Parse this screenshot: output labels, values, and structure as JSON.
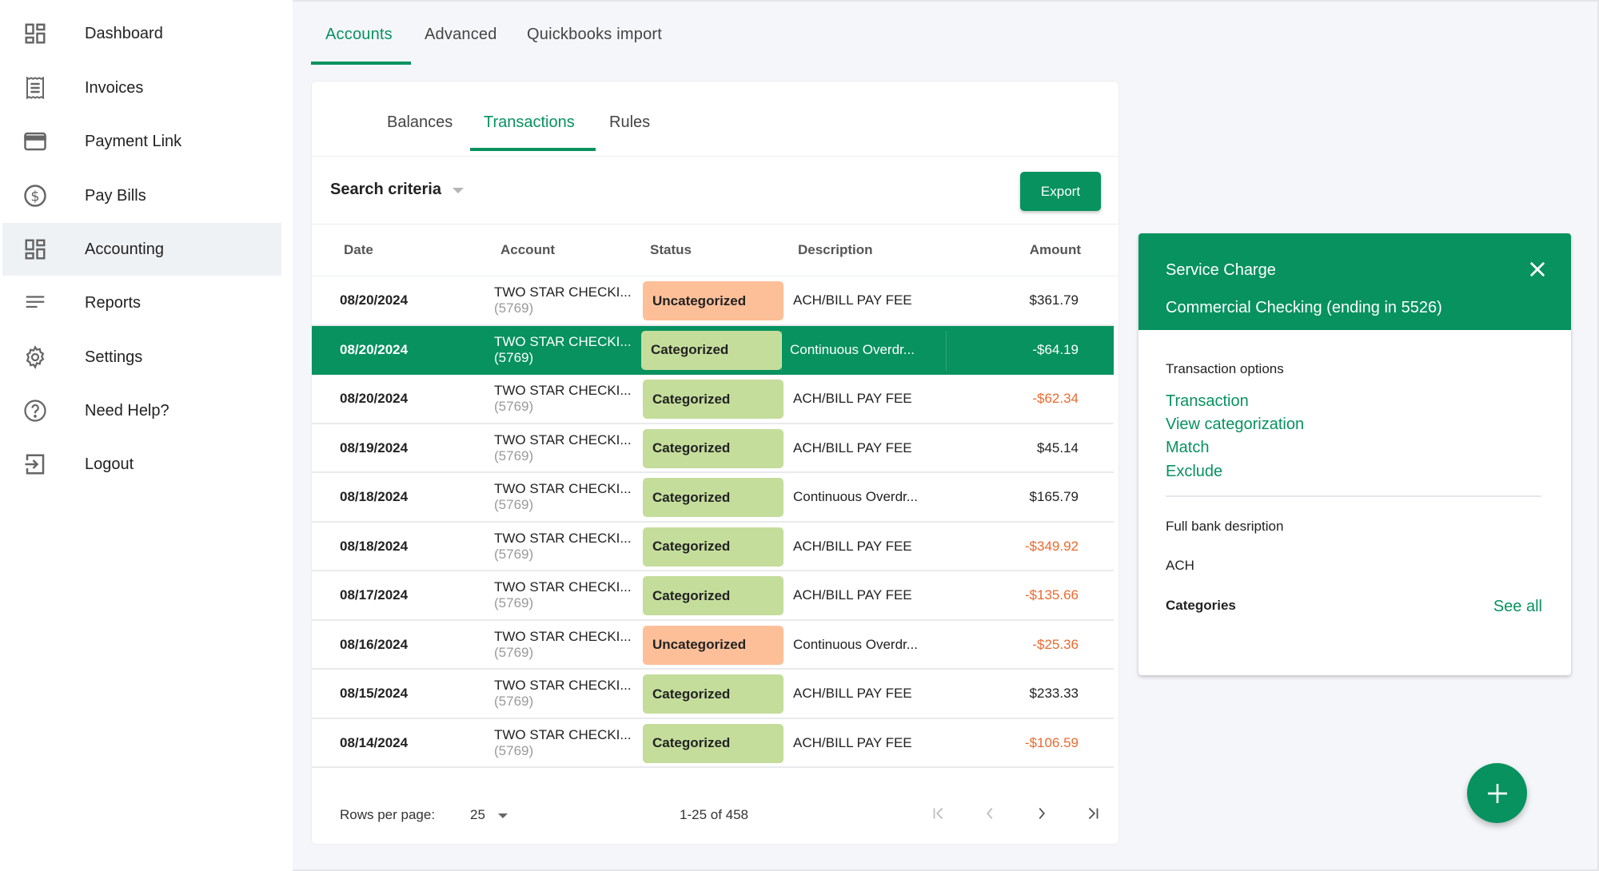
{
  "sidebar": {
    "items": [
      {
        "label": "Dashboard",
        "icon": "dashboard-icon"
      },
      {
        "label": "Invoices",
        "icon": "receipt-icon"
      },
      {
        "label": "Payment Link",
        "icon": "credit-card-icon"
      },
      {
        "label": "Pay Bills",
        "icon": "dollar-circle-icon"
      },
      {
        "label": "Accounting",
        "icon": "dashboard-icon",
        "active": true
      },
      {
        "label": "Reports",
        "icon": "lines-icon"
      },
      {
        "label": "Settings",
        "icon": "gear-icon"
      },
      {
        "label": "Need Help?",
        "icon": "help-circle-icon"
      },
      {
        "label": "Logout",
        "icon": "logout-icon"
      }
    ]
  },
  "top_tabs": [
    {
      "label": "Accounts",
      "active": true
    },
    {
      "label": "Advanced"
    },
    {
      "label": "Quickbooks import"
    }
  ],
  "sub_tabs": [
    {
      "label": "Balances"
    },
    {
      "label": "Transactions",
      "active": true
    },
    {
      "label": "Rules"
    }
  ],
  "toolbar": {
    "search_criteria_label": "Search criteria",
    "export_label": "Export"
  },
  "table": {
    "columns": [
      "Date",
      "Account",
      "Status",
      "Description",
      "Amount"
    ],
    "rows": [
      {
        "date": "08/20/2024",
        "account": "TWO STAR CHECKI...",
        "account_num": "(5769)",
        "status": "Uncategorized",
        "description": "ACH/BILL PAY FEE",
        "amount": "$361.79",
        "negative": false
      },
      {
        "date": "08/20/2024",
        "account": "TWO STAR CHECKI...",
        "account_num": "(5769)",
        "status": "Categorized",
        "description": "Continuous Overdr...",
        "amount": "-$64.19",
        "negative": true,
        "selected": true
      },
      {
        "date": "08/20/2024",
        "account": "TWO STAR CHECKI...",
        "account_num": "(5769)",
        "status": "Categorized",
        "description": "ACH/BILL PAY FEE",
        "amount": "-$62.34",
        "negative": true
      },
      {
        "date": "08/19/2024",
        "account": "TWO STAR CHECKI...",
        "account_num": "(5769)",
        "status": "Categorized",
        "description": "ACH/BILL PAY FEE",
        "amount": "$45.14",
        "negative": false
      },
      {
        "date": "08/18/2024",
        "account": "TWO STAR CHECKI...",
        "account_num": "(5769)",
        "status": "Categorized",
        "description": "Continuous Overdr...",
        "amount": "$165.79",
        "negative": false
      },
      {
        "date": "08/18/2024",
        "account": "TWO STAR CHECKI...",
        "account_num": "(5769)",
        "status": "Categorized",
        "description": "ACH/BILL PAY FEE",
        "amount": "-$349.92",
        "negative": true
      },
      {
        "date": "08/17/2024",
        "account": "TWO STAR CHECKI...",
        "account_num": "(5769)",
        "status": "Categorized",
        "description": "ACH/BILL PAY FEE",
        "amount": "-$135.66",
        "negative": true
      },
      {
        "date": "08/16/2024",
        "account": "TWO STAR CHECKI...",
        "account_num": "(5769)",
        "status": "Uncategorized",
        "description": "Continuous Overdr...",
        "amount": "-$25.36",
        "negative": true
      },
      {
        "date": "08/15/2024",
        "account": "TWO STAR CHECKI...",
        "account_num": "(5769)",
        "status": "Categorized",
        "description": "ACH/BILL PAY FEE",
        "amount": "$233.33",
        "negative": false
      },
      {
        "date": "08/14/2024",
        "account": "TWO STAR CHECKI...",
        "account_num": "(5769)",
        "status": "Categorized",
        "description": "ACH/BILL PAY FEE",
        "amount": "-$106.59",
        "negative": true
      }
    ]
  },
  "pagination": {
    "rows_per_page_label": "Rows per page:",
    "rows_per_page_value": "25",
    "range_text": "1-25 of 458"
  },
  "detail_panel": {
    "title": "Service Charge",
    "subtitle": "Commercial Checking (ending in 5526)",
    "options_heading": "Transaction options",
    "options": [
      "Transaction",
      "View categorization",
      "Match",
      "Exclude"
    ],
    "bank_desc_label": "Full bank desription",
    "bank_desc_value": "ACH",
    "categories_label": "Categories",
    "see_all_label": "See all"
  },
  "colors": {
    "accent": "#07925f",
    "categorized": "#c4dd9b",
    "uncategorized": "#fdbf98",
    "negative_amount": "#ea6a2f"
  }
}
